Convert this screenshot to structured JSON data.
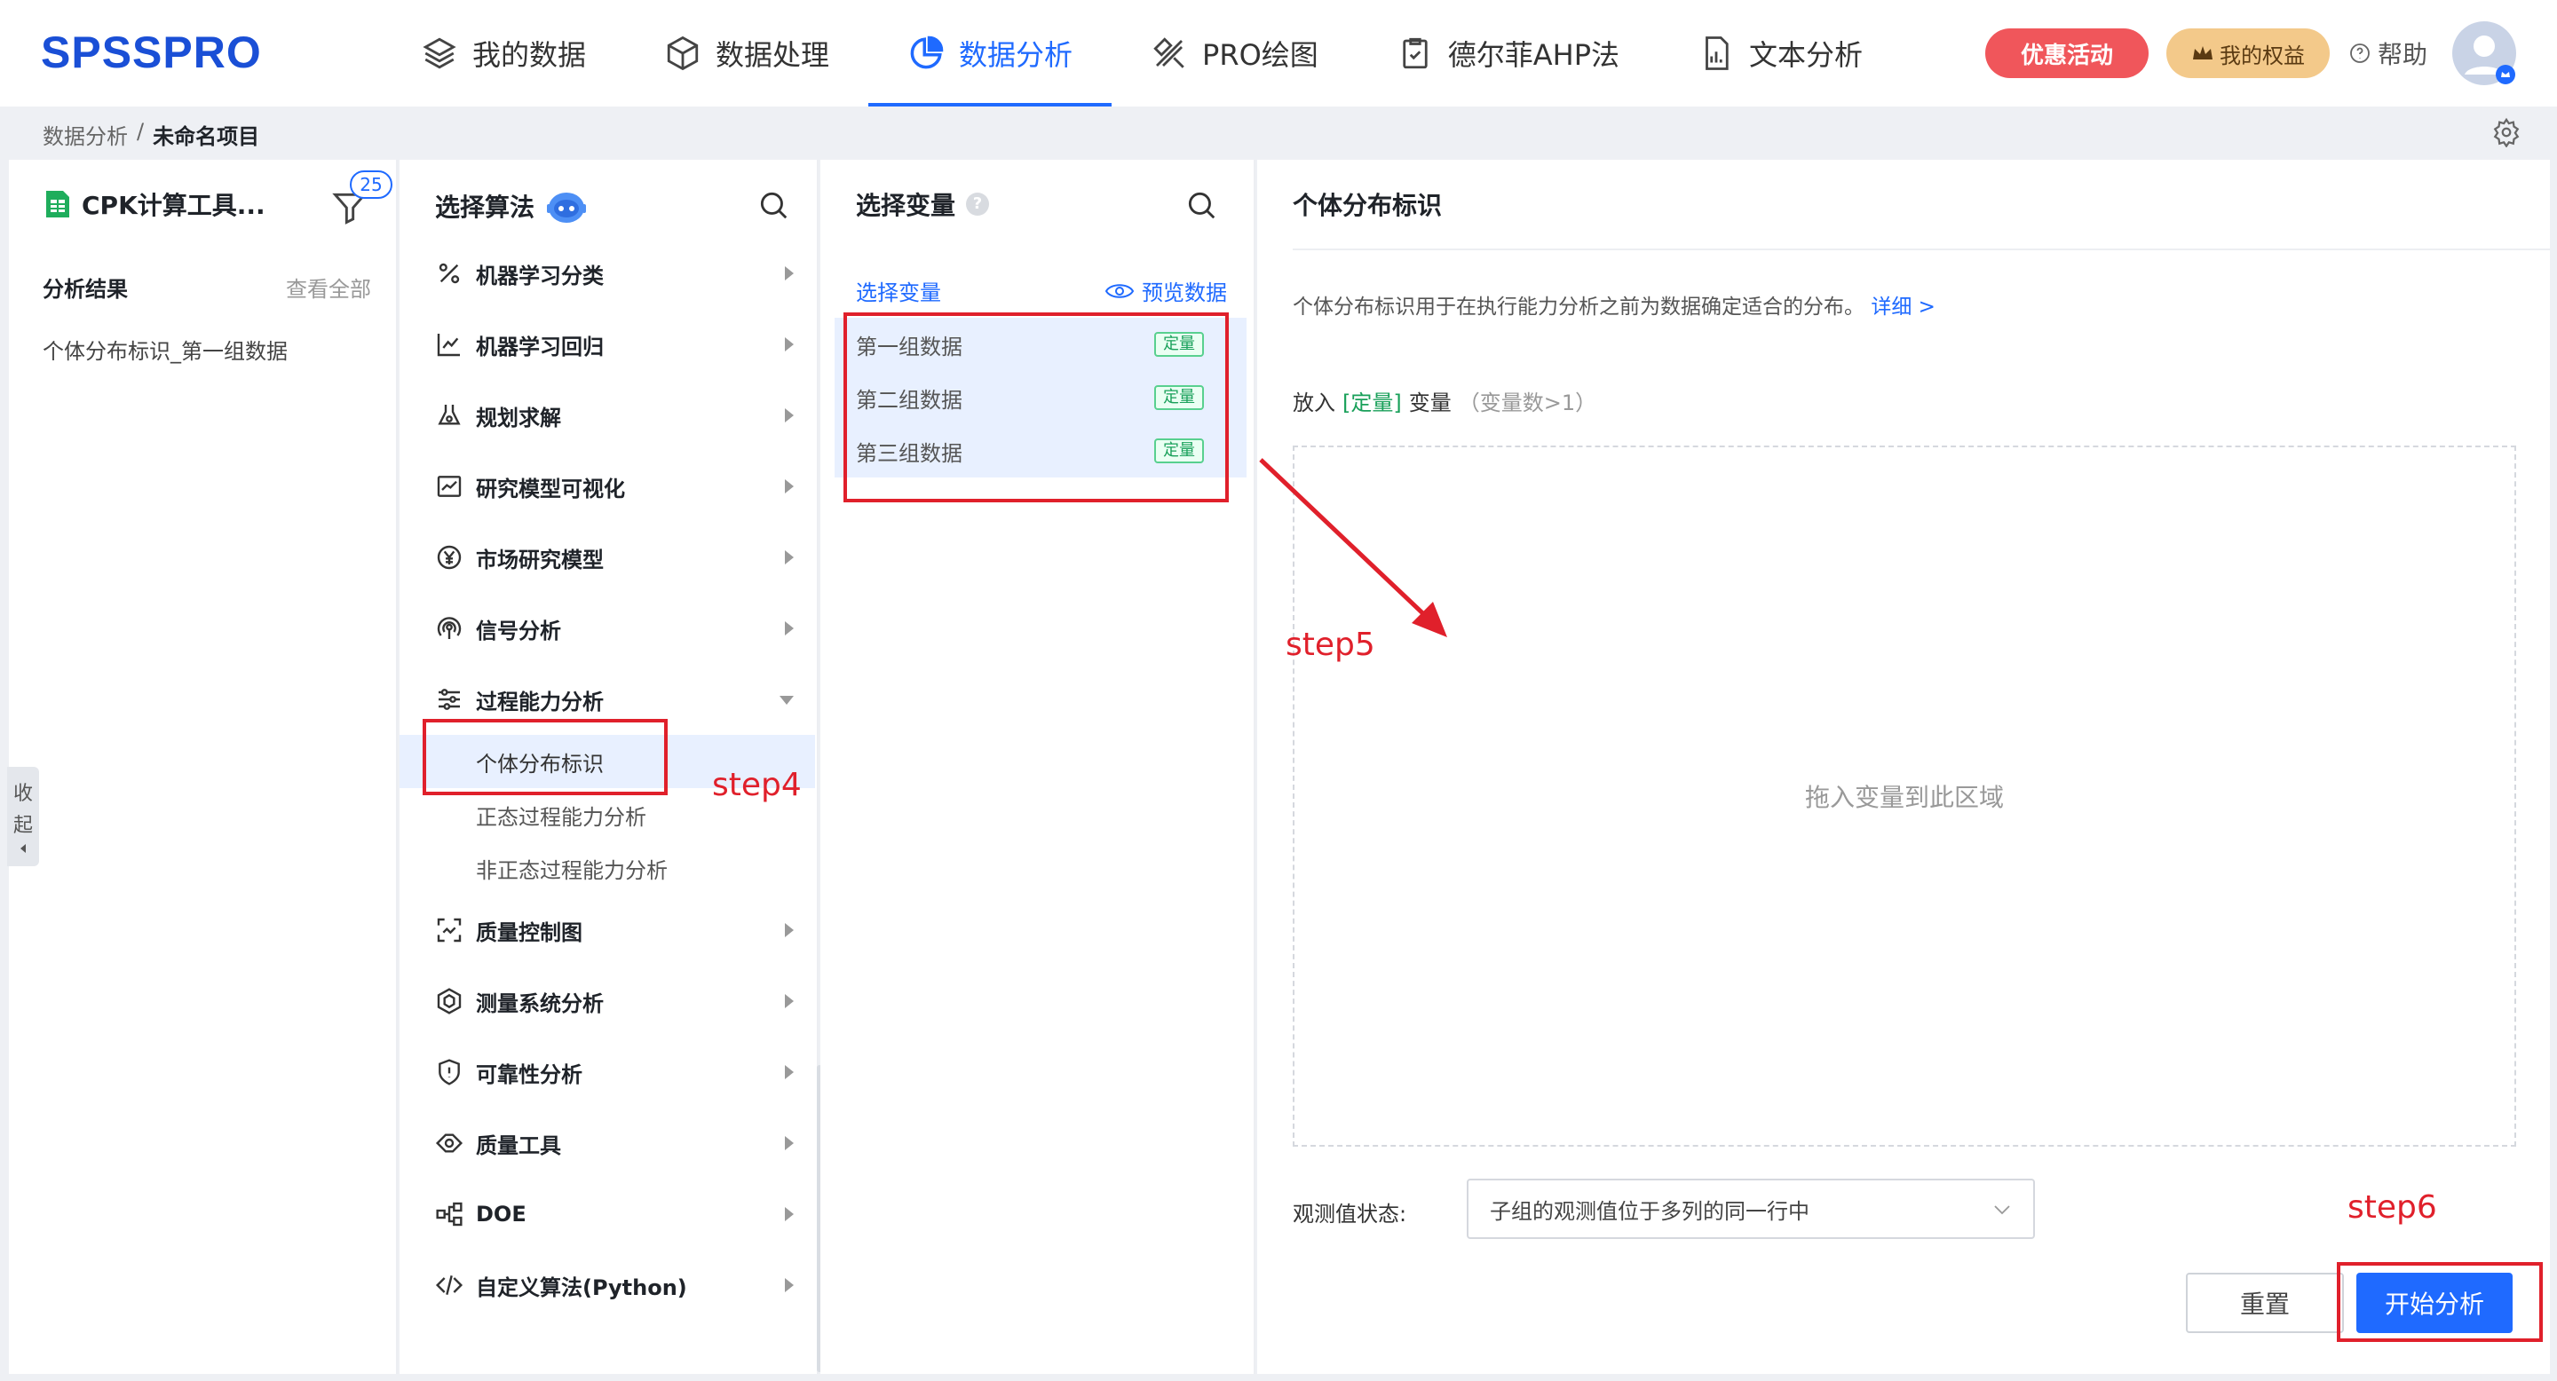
{
  "app": {
    "logo": "SPSSPRO"
  },
  "nav": [
    {
      "label": "我的数据",
      "icon": "layers-icon",
      "active": false
    },
    {
      "label": "数据处理",
      "icon": "cube-icon",
      "active": false
    },
    {
      "label": "数据分析",
      "icon": "pie-chart-icon",
      "active": true
    },
    {
      "label": "PRO绘图",
      "icon": "ruler-pencil-icon",
      "active": false
    },
    {
      "label": "德尔菲AHP法",
      "icon": "clipboard-check-icon",
      "active": false
    },
    {
      "label": "文本分析",
      "icon": "document-chart-icon",
      "active": false
    }
  ],
  "header": {
    "promo": "优惠活动",
    "rights": "我的权益",
    "help": "帮助"
  },
  "breadcrumb": {
    "parent": "数据分析",
    "sep": "/",
    "current": "未命名项目"
  },
  "project": {
    "title": "CPK计算工具...",
    "filter_count": "25",
    "results_title": "分析结果",
    "view_all": "查看全部",
    "result_item": "个体分布标识_第一组数据",
    "collapse": [
      "收",
      "起"
    ]
  },
  "algorithms": {
    "title": "选择算法",
    "groups": [
      {
        "label": "机器学习分类",
        "icon": "percent-icon"
      },
      {
        "label": "机器学习回归",
        "icon": "scatter-icon"
      },
      {
        "label": "规划求解",
        "icon": "flask-icon"
      },
      {
        "label": "研究模型可视化",
        "icon": "line-chart-icon"
      },
      {
        "label": "市场研究模型",
        "icon": "yen-icon"
      },
      {
        "label": "信号分析",
        "icon": "signal-icon"
      },
      {
        "label": "过程能力分析",
        "icon": "sliders-icon",
        "expanded": true,
        "children": [
          "个体分布标识",
          "正态过程能力分析",
          "非正态过程能力分析"
        ]
      },
      {
        "label": "质量控制图",
        "icon": "scan-icon"
      },
      {
        "label": "测量系统分析",
        "icon": "hexagon-icon"
      },
      {
        "label": "可靠性分析",
        "icon": "shield-icon"
      },
      {
        "label": "质量工具",
        "icon": "tag-icon"
      },
      {
        "label": "DOE",
        "icon": "nodes-icon"
      },
      {
        "label": "自定义算法(Python)",
        "icon": "code-icon"
      }
    ]
  },
  "variables": {
    "title": "选择变量",
    "subtitle": "选择变量",
    "preview": "预览数据",
    "items": [
      {
        "name": "第一组数据",
        "tag": "定量"
      },
      {
        "name": "第二组数据",
        "tag": "定量"
      },
      {
        "name": "第三组数据",
        "tag": "定量"
      }
    ]
  },
  "detail": {
    "title": "个体分布标识",
    "desc": "个体分布标识用于在执行能力分析之前为数据确定适合的分布。",
    "desc_link": "详细 >",
    "put_prefix": "放入",
    "put_tag": "[定量]",
    "put_suffix": "变量",
    "put_hint": "（变量数>1）",
    "drop_hint": "拖入变量到此区域",
    "obs_label": "观测值状态:",
    "obs_value": "子组的观测值位于多列的同一行中",
    "reset": "重置",
    "start": "开始分析"
  },
  "annotations": {
    "step4": "step4",
    "step5": "step5",
    "step6": "step6",
    "color": "#e0202b"
  },
  "colors": {
    "accent": "#1f6aff",
    "promo": "#f0565b",
    "tag_green": "#19a05a"
  }
}
